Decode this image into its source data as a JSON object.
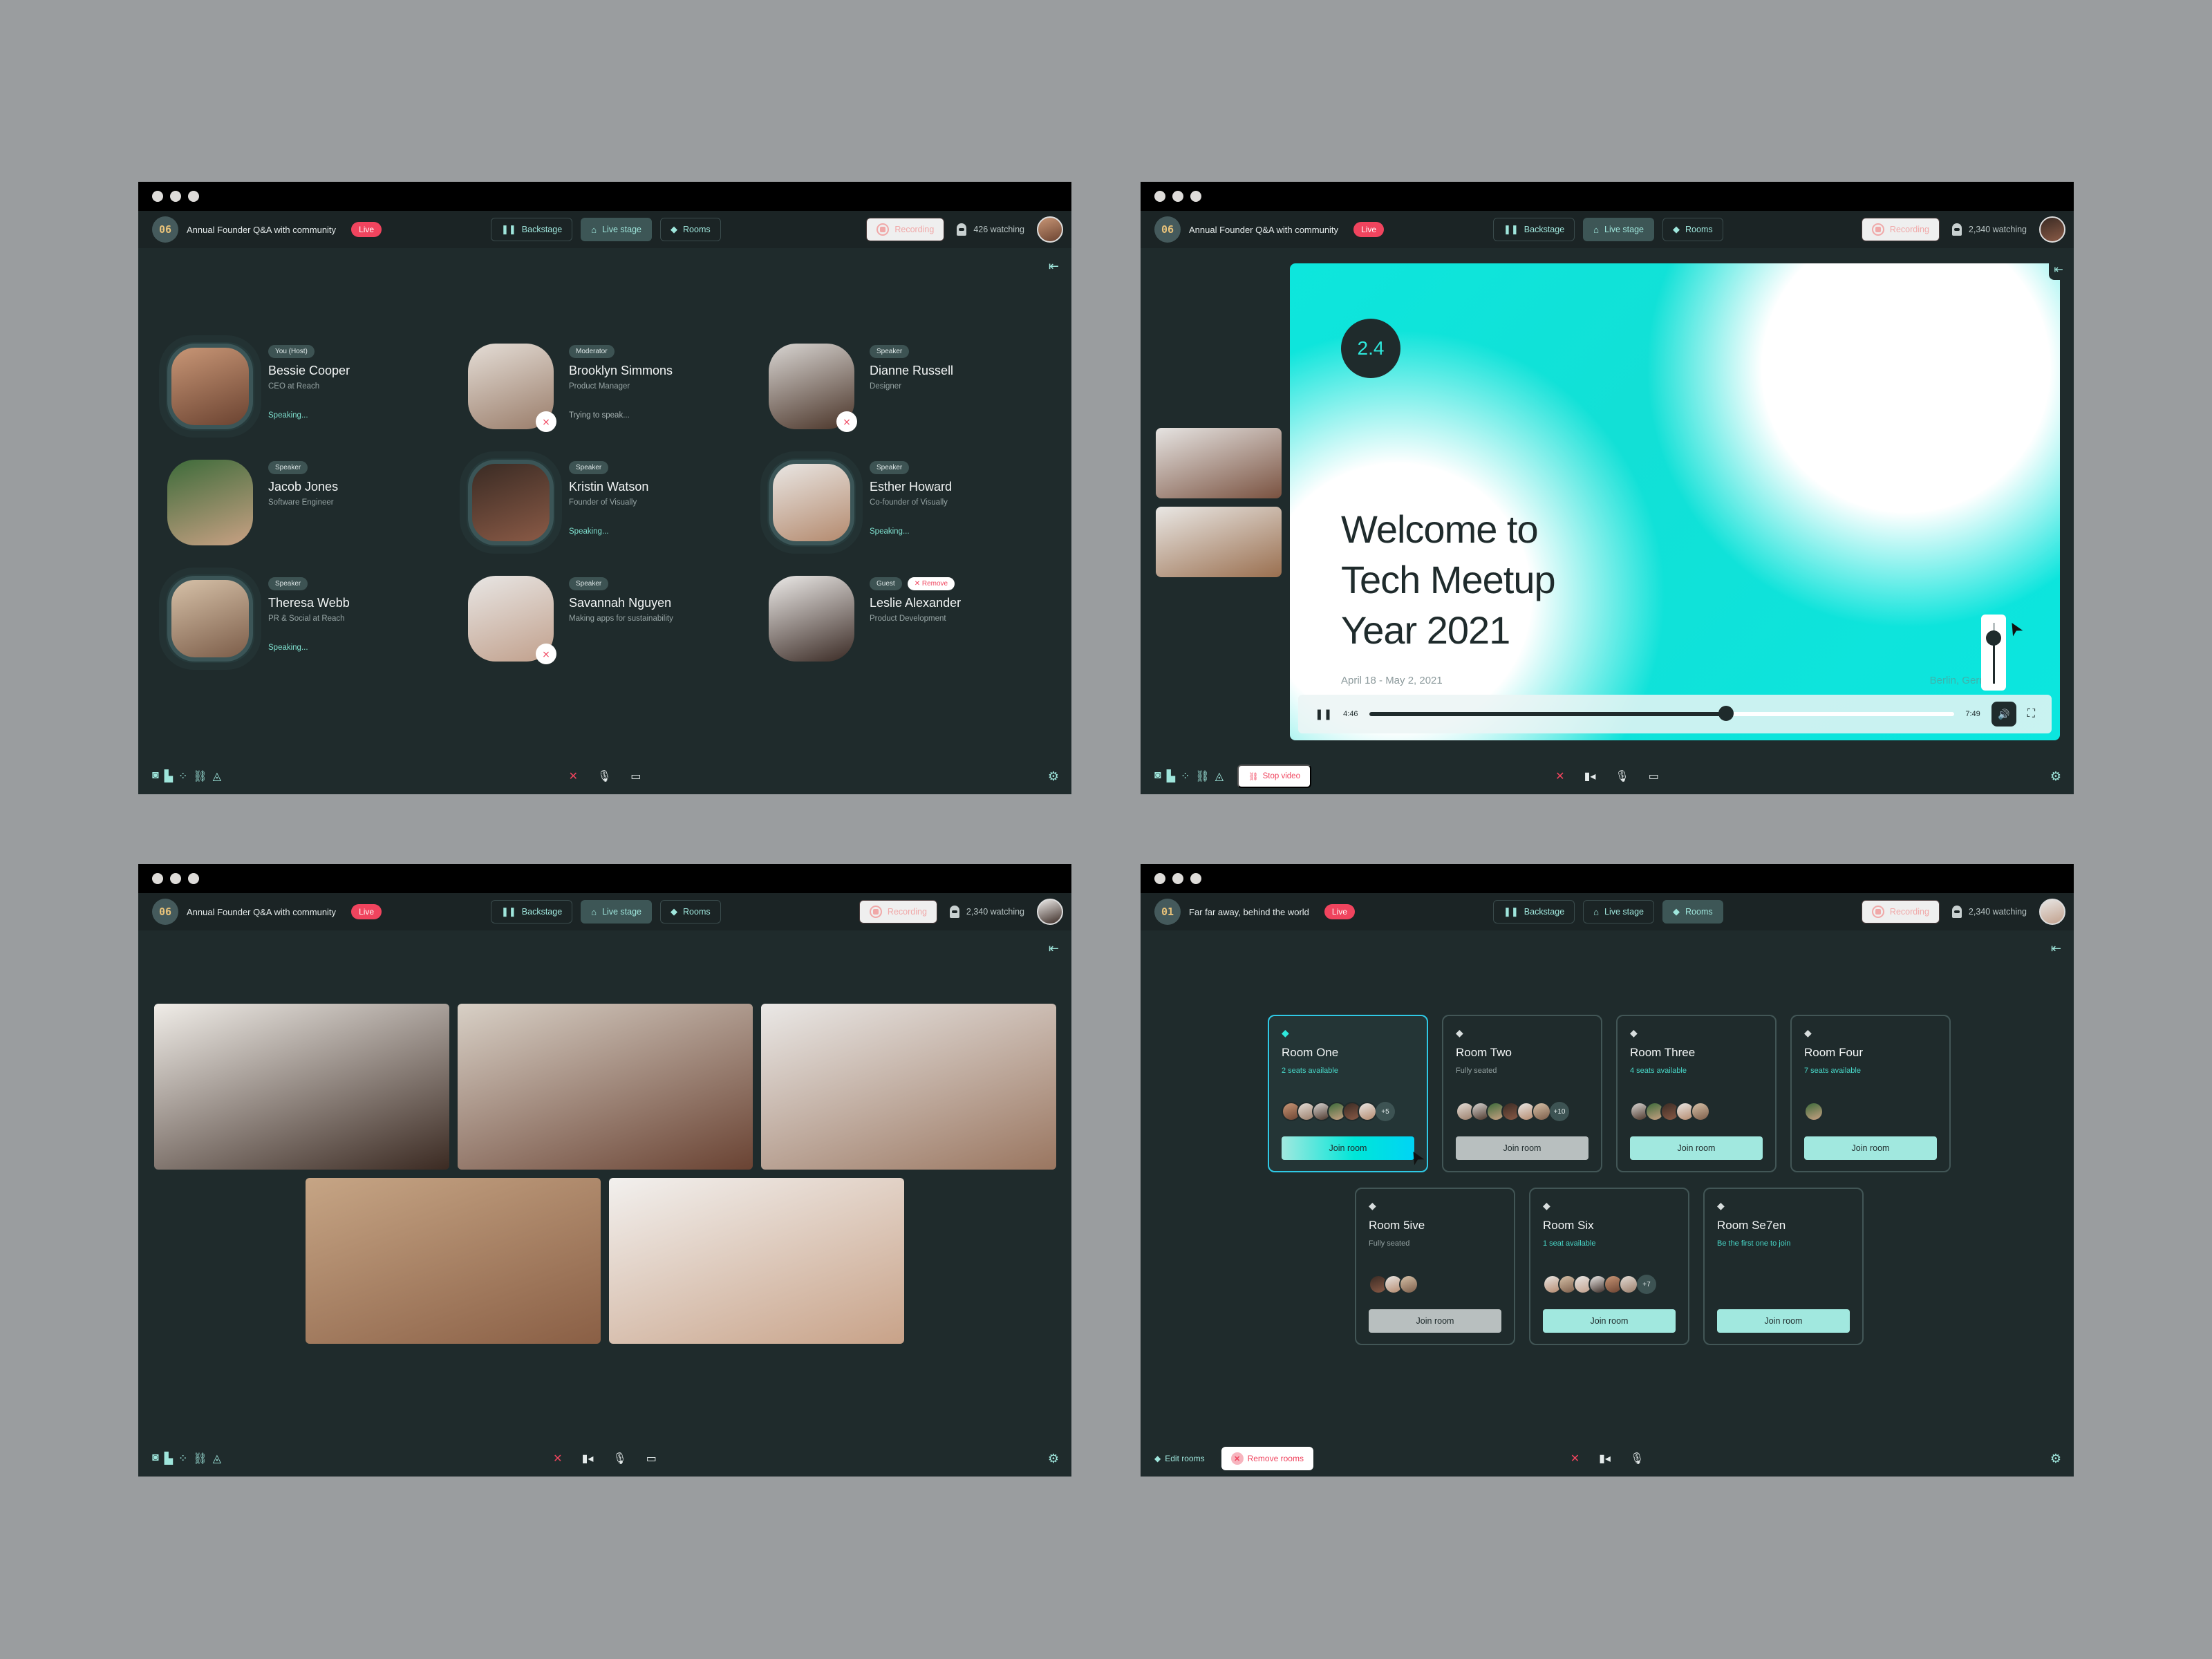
{
  "colors": {
    "accent": "#9fe6dc",
    "live": "#f0445e",
    "recording": "#f0a8a8",
    "background": "#1f2b2c",
    "page": "#9a9d9f"
  },
  "icons": {
    "backstage": "pause-bars-icon",
    "live_stage": "house-icon",
    "rooms": "layers-diamond-icon",
    "recording": "record-icon",
    "watching": "viewer-icon",
    "collapse": "collapse-left-icon",
    "camera": "camera-icon",
    "chart": "chart-icon",
    "apps": "apps-icon",
    "link": "link-icon",
    "paint": "paint-bucket-icon",
    "hangup": "hangup-x-icon",
    "video": "video-icon",
    "mic": "mic-icon",
    "screen": "screen-share-icon",
    "settings": "gear-icon",
    "mic_muted": "mic-muted-icon"
  },
  "glyphs": {
    "backstage": "❚❚",
    "live_stage": "⌂",
    "rooms": "◆",
    "collapse": "⇤",
    "camera": "◙",
    "chart": "▙",
    "apps": "⁘",
    "link": "⛓",
    "paint": "◬",
    "hangup": "✕",
    "video": "▮◂",
    "mic": "🎙",
    "screen": "▭",
    "gear": "⚙",
    "mute": "⨯",
    "pause": "❚❚",
    "volume": "🔊",
    "fullscreen": "⛶",
    "cursor": "➤"
  },
  "windows": [
    {
      "event_number": "06",
      "title": "Annual Founder Q&A with community",
      "live_label": "Live",
      "nav": {
        "backstage": "Backstage",
        "live_stage": "Live stage",
        "rooms": "Rooms",
        "active": "Live stage"
      },
      "recording_label": "Recording",
      "watching": "426 watching",
      "speakers": [
        {
          "tag": "You (Host)",
          "name": "Bessie Cooper",
          "role": "CEO at Reach",
          "status": "Speaking...",
          "speaking": true,
          "muted": false
        },
        {
          "tag": "Moderator",
          "name": "Brooklyn Simmons",
          "role": "Product Manager",
          "status": "Trying to speak...",
          "speaking": false,
          "muted": true
        },
        {
          "tag": "Speaker",
          "name": "Dianne Russell",
          "role": "Designer",
          "status": "",
          "speaking": false,
          "muted": true
        },
        {
          "tag": "Speaker",
          "name": "Jacob Jones",
          "role": "Software Engineer",
          "status": "",
          "speaking": false,
          "muted": false
        },
        {
          "tag": "Speaker",
          "name": "Kristin Watson",
          "role": "Founder of Visually",
          "status": "Speaking...",
          "speaking": true,
          "muted": false
        },
        {
          "tag": "Speaker",
          "name": "Esther Howard",
          "role": "Co-founder of Visually",
          "status": "Speaking...",
          "speaking": true,
          "muted": false
        },
        {
          "tag": "Speaker",
          "name": "Theresa Webb",
          "role": "PR & Social at Reach",
          "status": "Speaking...",
          "speaking": true,
          "muted": false
        },
        {
          "tag": "Speaker",
          "name": "Savannah Nguyen",
          "role": "Making apps for sustainability",
          "status": "",
          "speaking": false,
          "muted": true
        },
        {
          "tag": "Guest",
          "name": "Leslie Alexander",
          "role": "Product Development",
          "status": "",
          "speaking": false,
          "muted": false,
          "remove_label": "Remove"
        }
      ]
    },
    {
      "event_number": "06",
      "title": "Annual Founder Q&A with community",
      "live_label": "Live",
      "nav": {
        "backstage": "Backstage",
        "live_stage": "Live stage",
        "rooms": "Rooms",
        "active": "Live stage"
      },
      "recording_label": "Recording",
      "watching": "2,340 watching",
      "slide": {
        "badge": "2.4",
        "title_lines": [
          "Welcome to",
          "Tech Meetup",
          "Year 2021"
        ],
        "date": "April 18 - May 2, 2021",
        "location": "Berlin, Germany"
      },
      "player": {
        "current_time": "4:46",
        "duration": "7:49",
        "progress": 0.61,
        "volume": 0.75
      },
      "stop_video_label": "Stop video"
    },
    {
      "event_number": "06",
      "title": "Annual Founder Q&A with community",
      "live_label": "Live",
      "nav": {
        "backstage": "Backstage",
        "live_stage": "Live stage",
        "rooms": "Rooms",
        "active": "Live stage"
      },
      "recording_label": "Recording",
      "watching": "2,340 watching",
      "video_tiles": 5
    },
    {
      "event_number": "01",
      "title": "Far far away, behind the world",
      "live_label": "Live",
      "nav": {
        "backstage": "Backstage",
        "live_stage": "Live stage",
        "rooms": "Rooms",
        "active": "Rooms"
      },
      "recording_label": "Recording",
      "watching": "2,340 watching",
      "rooms": [
        {
          "name": "Room One",
          "seats": "2 seats available",
          "full": false,
          "avatars": 6,
          "more": "+5",
          "join": "Join room",
          "selected": true
        },
        {
          "name": "Room Two",
          "seats": "Fully seated",
          "full": true,
          "avatars": 6,
          "more": "+10",
          "join": "Join room",
          "selected": false
        },
        {
          "name": "Room Three",
          "seats": "4 seats available",
          "full": false,
          "avatars": 5,
          "more": "",
          "join": "Join room",
          "selected": false
        },
        {
          "name": "Room Four",
          "seats": "7 seats available",
          "full": false,
          "avatars": 1,
          "more": "",
          "join": "Join room",
          "selected": false
        },
        {
          "name": "Room 5ive",
          "seats": "Fully seated",
          "full": true,
          "avatars": 3,
          "more": "",
          "join": "Join room",
          "selected": false
        },
        {
          "name": "Room Six",
          "seats": "1 seat available",
          "full": false,
          "avatars": 6,
          "more": "+7",
          "join": "Join room",
          "selected": false
        },
        {
          "name": "Room Se7en",
          "seats": "Be the first one to join",
          "full": false,
          "avatars": 0,
          "more": "",
          "join": "Join room",
          "selected": false
        }
      ],
      "edit_rooms_label": "Edit rooms",
      "remove_rooms_label": "Remove rooms"
    }
  ]
}
